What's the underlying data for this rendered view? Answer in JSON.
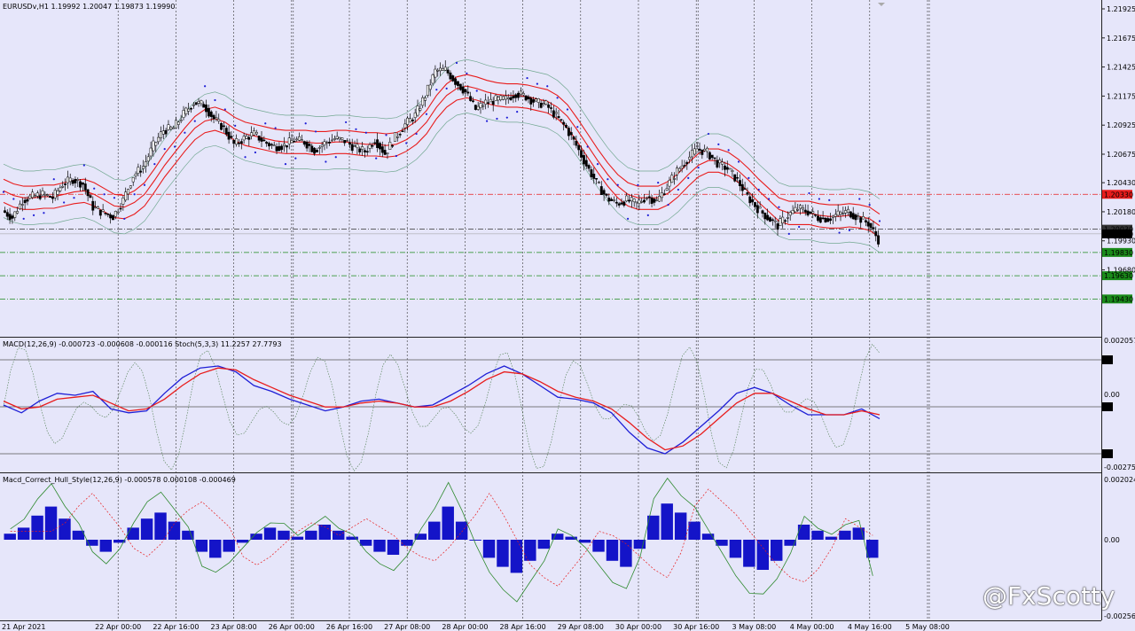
{
  "window": {
    "header": "EURUSDv,H1  1.19992 1.20047 1.19873 1.19990"
  },
  "chart_data": [
    {
      "type": "candlestick",
      "panel": "price",
      "symbol": "EURUSDv",
      "timeframe": "H1",
      "ohlc": {
        "open": 1.19992,
        "high": 1.20047,
        "low": 1.19873,
        "close": 1.1999
      },
      "ylim": [
        1.1932,
        1.2212
      ],
      "y_ticks": [
        "1.21925",
        "1.21675",
        "1.21425",
        "1.21175",
        "1.20925",
        "1.20675",
        "1.20430",
        "1.20180",
        "1.19930",
        "1.19680"
      ],
      "level_lines": [
        {
          "value": 1.2033,
          "label": "1.20330",
          "color": "#e81c1c",
          "style": "dashdot"
        },
        {
          "value": 1.2003,
          "label": "1.20030",
          "color": "#333333",
          "style": "dashdot"
        },
        {
          "value": 1.1983,
          "label": "1.19830",
          "color": "#1a8a1a",
          "style": "dashdot"
        },
        {
          "value": 1.1963,
          "label": "1.19630",
          "color": "#1a8a1a",
          "style": "dashdot"
        },
        {
          "value": 1.1943,
          "label": "1.19430",
          "color": "#1a8a1a",
          "style": "dashdot"
        }
      ],
      "current_price": {
        "value": 1.1999,
        "label": "1.19900"
      },
      "path_close": [
        1.2019,
        1.2013,
        1.2028,
        1.2031,
        1.2033,
        1.203,
        1.2042,
        1.2046,
        1.2042,
        1.2022,
        1.2017,
        1.2014,
        1.2028,
        1.2049,
        1.2057,
        1.2075,
        1.2088,
        1.209,
        1.2102,
        1.2112,
        1.211,
        1.2098,
        1.209,
        1.2076,
        1.2081,
        1.2085,
        1.2078,
        1.2074,
        1.2075,
        1.208,
        1.2078,
        1.2071,
        1.2077,
        1.2081,
        1.2079,
        1.2073,
        1.207,
        1.208,
        1.2068,
        1.2082,
        1.2093,
        1.2101,
        1.2118,
        1.2139,
        1.214,
        1.213,
        1.2121,
        1.2106,
        1.2112,
        1.2114,
        1.2115,
        1.212,
        1.2117,
        1.2112,
        1.211,
        1.21,
        1.209,
        1.2075,
        1.2058,
        1.2043,
        1.203,
        1.2025,
        1.2028,
        1.2025,
        1.2031,
        1.2027,
        1.204,
        1.2053,
        1.2063,
        1.2072,
        1.2069,
        1.206,
        1.2055,
        1.2045,
        1.2031,
        1.2021,
        1.2013,
        1.2006,
        1.2015,
        1.2021,
        1.2018,
        1.2013,
        1.2012,
        1.2016,
        1.2018,
        1.2013,
        1.2008,
        1.1994
      ],
      "ma_center": [
        1.2036,
        1.2032,
        1.203,
        1.203,
        1.2031,
        1.2031,
        1.2033,
        1.2035,
        1.2036,
        1.2033,
        1.2028,
        1.2023,
        1.2022,
        1.2026,
        1.2033,
        1.2045,
        1.2058,
        1.2069,
        1.208,
        1.209,
        1.2096,
        1.2098,
        1.2095,
        1.2089,
        1.2085,
        1.2083,
        1.2081,
        1.2079,
        1.2078,
        1.2078,
        1.2078,
        1.2077,
        1.2077,
        1.2078,
        1.2078,
        1.2077,
        1.2076,
        1.2076,
        1.2075,
        1.2076,
        1.208,
        1.2086,
        1.2095,
        1.2108,
        1.2118,
        1.2124,
        1.2126,
        1.2124,
        1.2121,
        1.2119,
        1.2118,
        1.2118,
        1.2117,
        1.2115,
        1.2113,
        1.2108,
        1.21,
        1.2088,
        1.2075,
        1.2062,
        1.205,
        1.204,
        1.2033,
        1.203,
        1.203,
        1.203,
        1.2034,
        1.2041,
        1.205,
        1.2058,
        1.2062,
        1.2062,
        1.2059,
        1.2053,
        1.2045,
        1.2036,
        1.2028,
        1.202,
        1.2017,
        1.2017,
        1.2017,
        1.2015,
        1.2014,
        1.2014,
        1.2015,
        1.2014,
        1.2012,
        1.2006
      ]
    },
    {
      "type": "line",
      "panel": "macd_stoch",
      "header": "MACD(12,26,9) -0.000723 -0.000608 -0.000116  Stoch(5,3,3) 11.2257 27.7793",
      "y_ticks": [
        "0.002057",
        "0.00",
        "-0.002752"
      ],
      "levels": [
        85,
        50,
        15
      ],
      "series": [
        {
          "name": "MACD",
          "color": "#1f1fd6",
          "values": [
            0.0,
            -0.0004,
            0.0002,
            0.0006,
            0.0005,
            0.0007,
            -0.0002,
            -0.0004,
            -0.0003,
            0.0006,
            0.0014,
            0.0019,
            0.002,
            0.0017,
            0.001,
            0.0007,
            0.0003,
            0.0,
            -0.0003,
            -0.0001,
            0.0002,
            0.0003,
            0.0001,
            -0.0001,
            0.0,
            0.0005,
            0.001,
            0.0016,
            0.002,
            0.0016,
            0.001,
            0.0004,
            0.0003,
            0.0001,
            -0.0004,
            -0.0014,
            -0.0022,
            -0.0025,
            -0.0019,
            -0.0011,
            -0.0003,
            0.0006,
            0.0009,
            0.0006,
            0.0,
            -0.0005,
            -0.0005,
            -0.0005,
            -0.0002,
            -0.0007
          ]
        },
        {
          "name": "Signal",
          "color": "#e81c1c",
          "values": [
            0.0002,
            -0.0002,
            -0.0001,
            0.0003,
            0.0004,
            0.0005,
            0.0001,
            -0.0003,
            -0.0002,
            0.0003,
            0.001,
            0.0016,
            0.0019,
            0.0018,
            0.0013,
            0.0009,
            0.0005,
            0.0002,
            -0.0001,
            -0.0001,
            0.0001,
            0.0002,
            0.0001,
            -0.0001,
            -0.0001,
            0.0002,
            0.0007,
            0.0013,
            0.0017,
            0.0016,
            0.0012,
            0.0007,
            0.0004,
            0.0002,
            -0.0002,
            -0.0009,
            -0.0017,
            -0.0023,
            -0.0021,
            -0.0015,
            -0.0007,
            0.0001,
            0.0006,
            0.0006,
            0.0002,
            -0.0002,
            -0.0005,
            -0.0005,
            -0.0003,
            -0.0005
          ]
        }
      ]
    },
    {
      "type": "histogram",
      "panel": "macd_hull",
      "header": "Macd_Correct_Hull_Style(12,26,9) -0.000578 0.000108 -0.000469",
      "y_ticks": [
        "0.002024",
        "0.00",
        "-0.002564"
      ],
      "values": [
        0.0002,
        0.0004,
        0.0008,
        0.0011,
        0.0007,
        0.0003,
        -0.0002,
        -0.0004,
        -0.0001,
        0.0004,
        0.0007,
        0.0009,
        0.0006,
        0.0003,
        -0.0004,
        -0.0006,
        -0.0004,
        -0.0001,
        0.0002,
        0.0004,
        0.0003,
        0.0001,
        0.0003,
        0.0005,
        0.0003,
        0.0001,
        -0.0002,
        -0.0004,
        -0.0005,
        -0.0002,
        0.0002,
        0.0006,
        0.0011,
        0.0006,
        0.0,
        -0.0006,
        -0.0009,
        -0.0011,
        -0.0007,
        -0.0003,
        0.0002,
        0.0001,
        -0.0001,
        -0.0004,
        -0.0007,
        -0.0009,
        -0.0003,
        0.0008,
        0.0012,
        0.0009,
        0.0006,
        0.0002,
        -0.0002,
        -0.0006,
        -0.0009,
        -0.001,
        -0.0007,
        -0.0002,
        0.0005,
        0.0003,
        0.0001,
        0.0003,
        0.0004,
        -0.0006
      ]
    }
  ],
  "x_axis": {
    "labels": [
      "21 Apr 2021",
      "22 Apr 00:00",
      "22 Apr 16:00",
      "23 Apr 08:00",
      "26 Apr 00:00",
      "26 Apr 16:00",
      "27 Apr 08:00",
      "28 Apr 00:00",
      "28 Apr 16:00",
      "29 Apr 08:00",
      "30 Apr 00:00",
      "30 Apr 16:00",
      "3 May 08:00",
      "4 May 00:00",
      "4 May 16:00",
      "5 May 08:00"
    ]
  },
  "watermark": "@FxScotty"
}
